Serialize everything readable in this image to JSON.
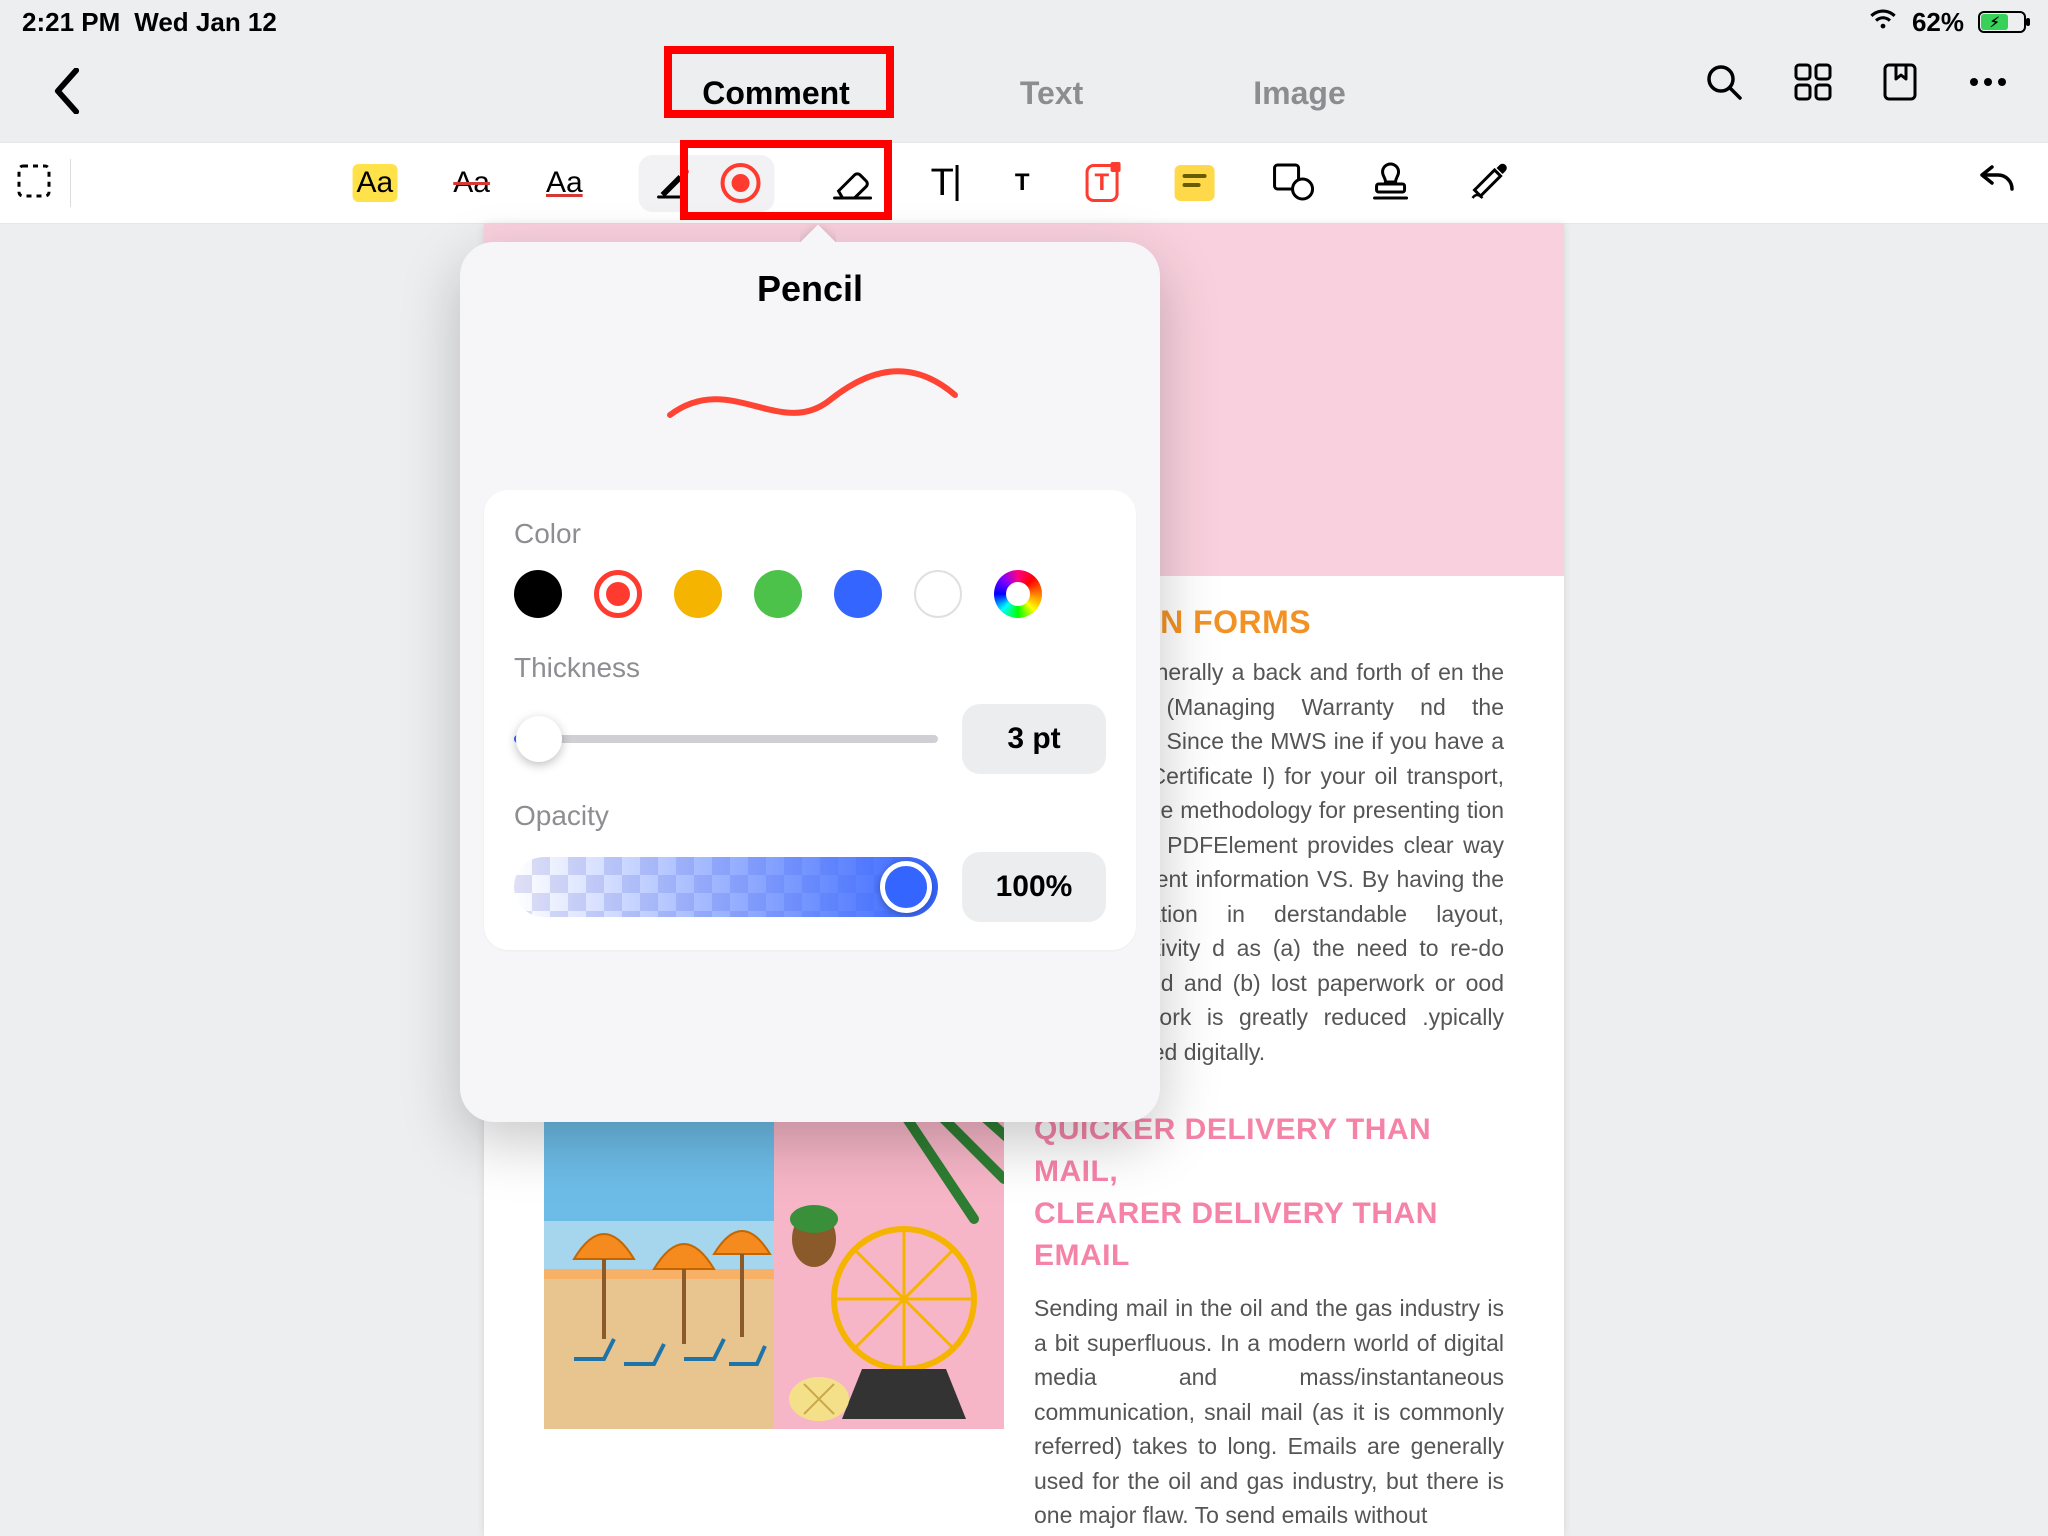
{
  "status": {
    "time": "2:21 PM",
    "date": "Wed Jan 12",
    "battery_pct": "62%",
    "wifi": true,
    "charging": true
  },
  "tabs": {
    "comment": "Comment",
    "text": "Text",
    "image": "Image",
    "active": "comment"
  },
  "popover": {
    "title": "Pencil",
    "color_label": "Color",
    "thickness_label": "Thickness",
    "thickness_value": "3 pt",
    "opacity_label": "Opacity",
    "opacity_value": "100%",
    "colors": [
      "#000000",
      "selected-red",
      "#f5b400",
      "#4cc24a",
      "#3565ff",
      "#ffffff",
      "rainbow"
    ]
  },
  "doc": {
    "heading1_fragment": "ATION FORMS",
    "para1_fragment": "n is generally a back and forth of en the MWS (Managing Warranty nd the insurer. Since the MWS ine if you have a COA (Certificate l) for your oil transport, a clear e methodology for presenting tion is vital. PDFElement provides  clear way to present information VS. By having the information in derstandable layout, productivity d as (a) the need to re-do tasks ed and (b) lost paperwork or ood paperwork is greatly reduced .ypically delivered digitally.",
    "heading2_line1": "QUICKER DELIVERY THAN MAIL,",
    "heading2_line2": "CLEARER DELIVERY THAN EMAIL",
    "para2": "Sending mail in the oil and the gas industry is a bit superfluous. In a modern world of digital media and mass/instantaneous communication, snail mail (as it is commonly referred) takes to long. Emails are generally used for the oil and gas industry, but there is one major flaw. To send emails without"
  }
}
